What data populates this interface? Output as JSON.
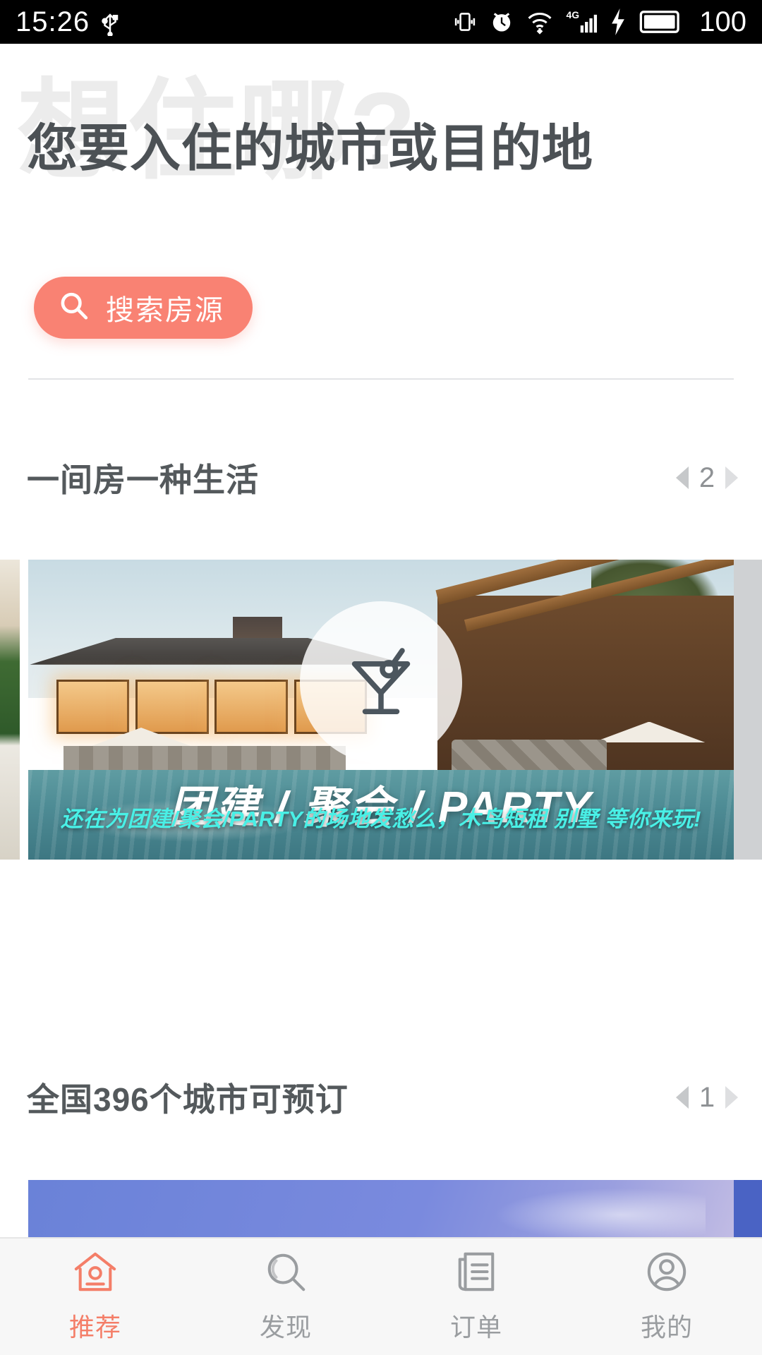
{
  "status_bar": {
    "time": "15:26",
    "battery_percent": "100",
    "icons": [
      "usb-icon",
      "vibrate-icon",
      "alarm-icon",
      "wifi-icon",
      "signal-4g-icon",
      "charging-bolt-icon",
      "battery-icon"
    ],
    "network_label": "4G",
    "background": "#000000",
    "foreground": "#ffffff"
  },
  "hero": {
    "watermark": "想住哪?",
    "title": "您要入住的城市或目的地",
    "search_button_label": "搜索房源",
    "search_icon": "search-icon",
    "accent_color": "#f98273"
  },
  "sections": [
    {
      "title": "一间房一种生活",
      "page_indicator": "2",
      "prev_icon": "triangle-left-icon",
      "next_icon": "triangle-right-icon",
      "banner": {
        "badge_icon": "cocktail-glass-icon",
        "title": "团建 / 聚会 / PARTY",
        "subtitle": "还在为团建/聚会/PARTY的场地发愁么，木鸟短租 别墅 等你来玩!",
        "title_color": "#ffffff",
        "subtitle_color": "#49f0e6"
      }
    },
    {
      "title": "全国396个城市可预订",
      "page_indicator": "1",
      "prev_icon": "triangle-left-icon",
      "next_icon": "triangle-right-icon"
    }
  ],
  "tabbar": {
    "active_color": "#f47e68",
    "inactive_color": "#9a9da0",
    "items": [
      {
        "label": "推荐",
        "icon": "home-house-icon",
        "active": true
      },
      {
        "label": "发现",
        "icon": "search-magnifier-icon",
        "active": false
      },
      {
        "label": "订单",
        "icon": "order-list-icon",
        "active": false
      },
      {
        "label": "我的",
        "icon": "user-profile-icon",
        "active": false
      }
    ]
  }
}
